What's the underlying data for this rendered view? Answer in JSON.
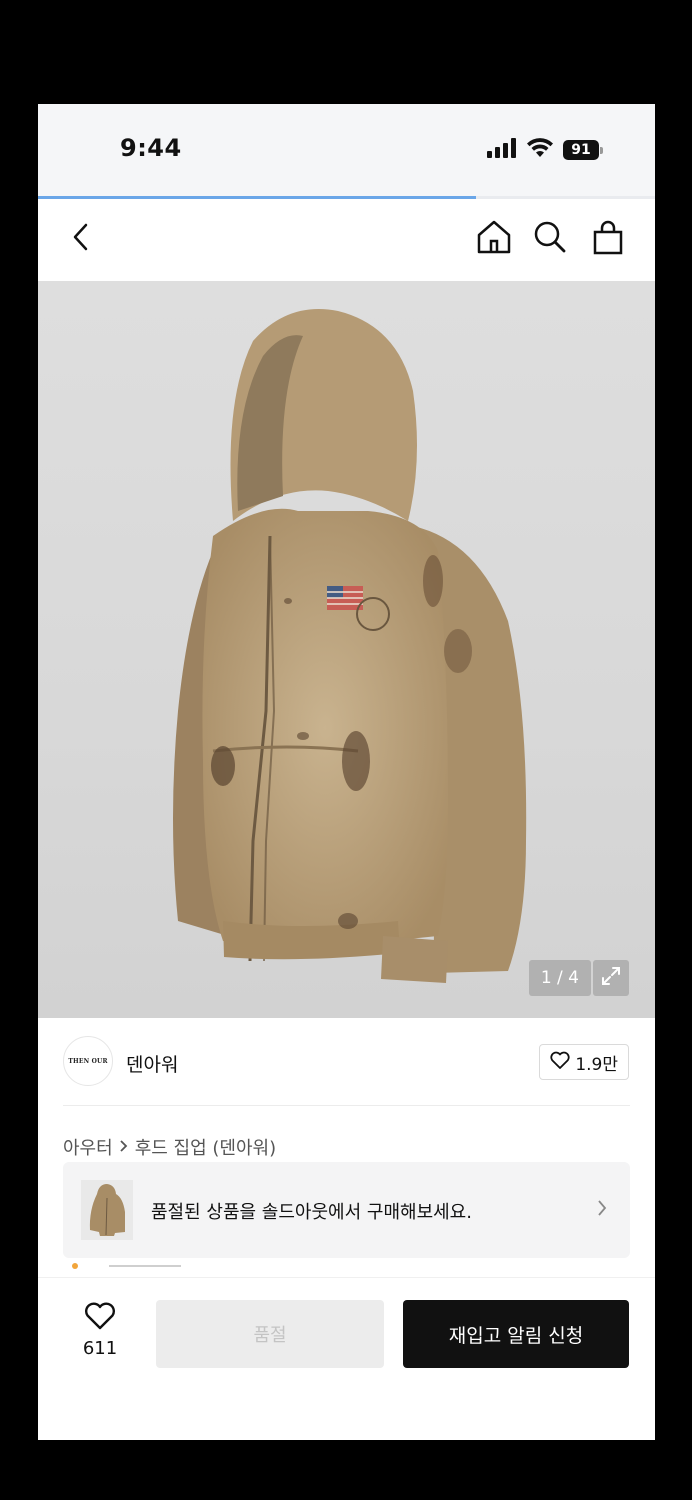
{
  "status_bar": {
    "time": "9:44",
    "battery": "91",
    "icons": [
      "signal-icon",
      "wifi-icon",
      "battery-icon"
    ]
  },
  "page_progress": 0.71,
  "nav": {
    "icons": [
      "back-icon",
      "home-icon",
      "search-icon",
      "bag-icon"
    ]
  },
  "gallery": {
    "counter": "1 / 4",
    "expand_icon": "expand-icon"
  },
  "brand": {
    "logo_text": "THEN OUR",
    "name": "덴아워",
    "likes": "1.9만"
  },
  "breadcrumb": {
    "category": "아우터",
    "subcategory": "후드 집업 (덴아워)"
  },
  "soldout_banner": {
    "text": "품절된 상품을 솔드아웃에서 구매해보세요."
  },
  "bottom_bar": {
    "wish_count": "611",
    "soldout_label": "품절",
    "restock_label": "재입고 알림 신청"
  },
  "colors": {
    "primary_button": "#111111",
    "disabled_button": "#ececec",
    "progress": "#6aa6e8",
    "hoodie": "#b49a74"
  }
}
